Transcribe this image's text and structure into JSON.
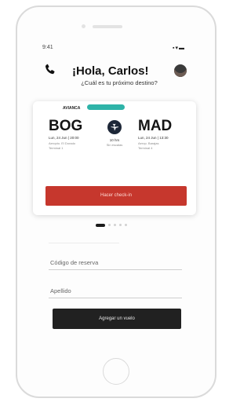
{
  "status_bar": {
    "time": "9:41",
    "icons_text": "▪▾▬"
  },
  "header": {
    "greeting": "¡Hola, Carlos!",
    "subtitle": "¿Cuál es tu próximo destino?"
  },
  "flight_card": {
    "airline": "AVIANCA",
    "status": "",
    "origin": {
      "code": "BOG",
      "datetime": "Lun, 24 Jun  |  20:00",
      "airport_1": "Aeropto. El Dorado",
      "airport_2": "Terminal 1"
    },
    "destination": {
      "code": "MAD",
      "datetime": "Lun, 24 Jun  |  13:30",
      "airport_1": "Aerop. Barajas",
      "airport_2": "Terminal 4"
    },
    "duration": "10 hrs",
    "stops": "Sin escalas",
    "checkin_label": "Hacer check-in"
  },
  "carousel": {
    "active_index": 0,
    "count": 5
  },
  "form": {
    "reservation_label": "Código de reserva",
    "lastname_label": "Apellido",
    "add_flight_label": "Agregar un vuelo"
  },
  "colors": {
    "checkin_red": "#c6372d",
    "status_teal": "#2eb3a8",
    "dark_button": "#212121"
  }
}
